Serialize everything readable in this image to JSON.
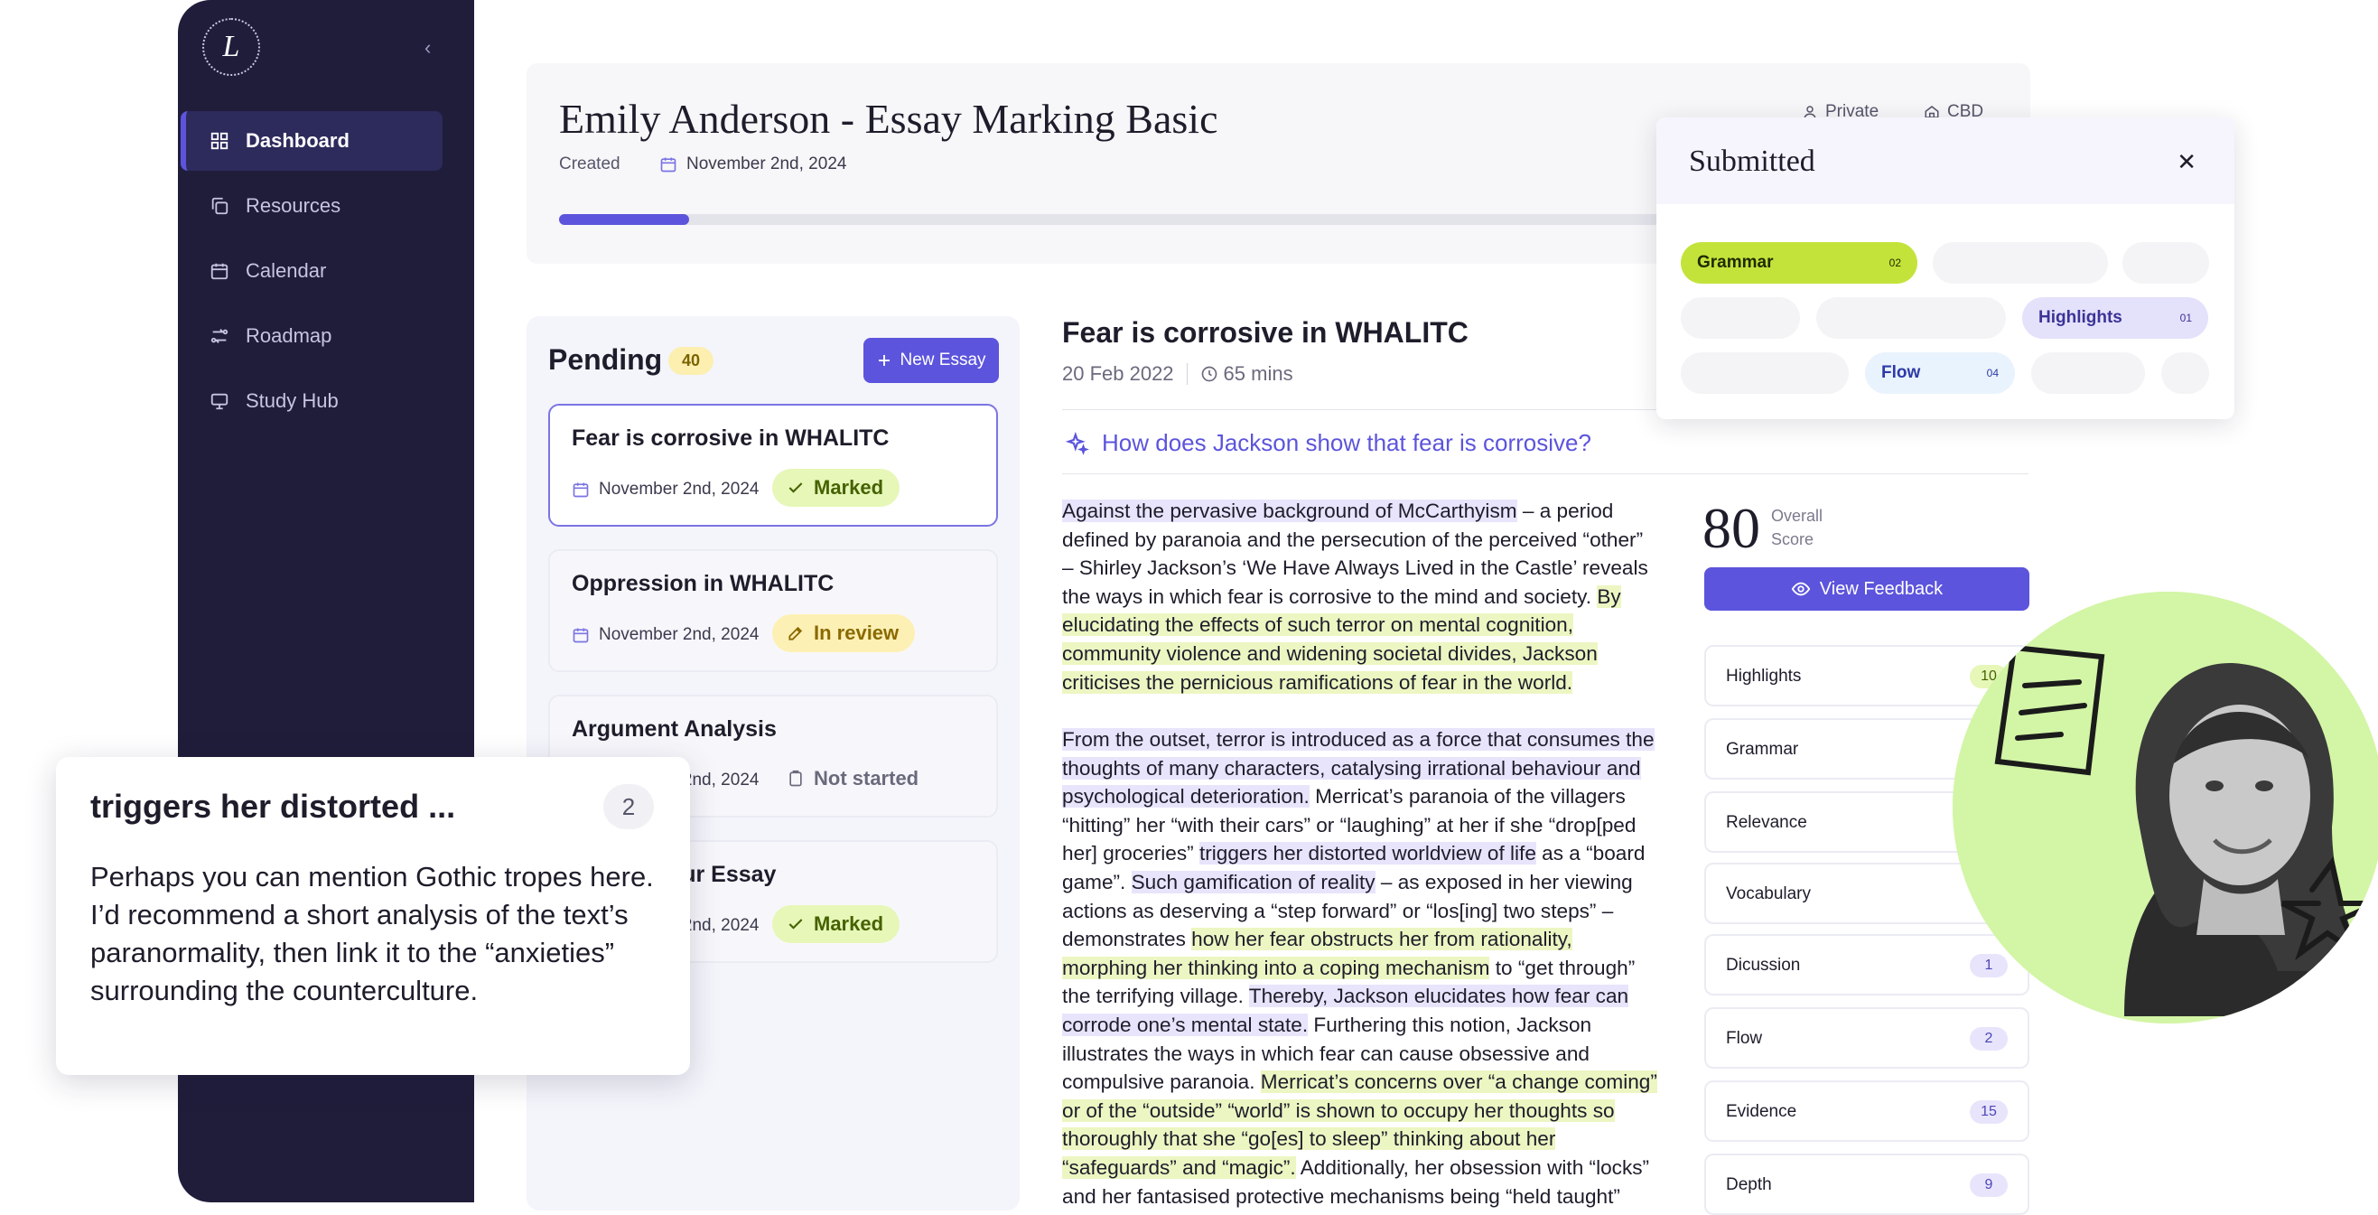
{
  "sidebar": {
    "logo_letter": "L",
    "collapse_glyph": "‹",
    "items": [
      {
        "label": "Dashboard",
        "icon": "grid-icon",
        "active": true
      },
      {
        "label": "Resources",
        "icon": "copy-icon"
      },
      {
        "label": "Calendar",
        "icon": "calendar-icon"
      },
      {
        "label": "Roadmap",
        "icon": "route-icon"
      },
      {
        "label": "Study Hub",
        "icon": "monitor-icon"
      }
    ]
  },
  "header": {
    "title": "Emily Anderson - Essay Marking Basic",
    "created_label": "Created",
    "created_date": "November 2nd, 2024",
    "visibility": "Private",
    "campus": "CBD",
    "progress": 0.115
  },
  "pending": {
    "title": "Pending",
    "count": "40",
    "new_button": "New Essay",
    "essays": [
      {
        "title": "Fear is corrosive in WHALITC",
        "date": "November 2nd, 2024",
        "status": "Marked"
      },
      {
        "title": "Oppression in WHALITC",
        "date": "November 2nd, 2024",
        "status": "In review"
      },
      {
        "title": "Argument Analysis",
        "date": "November 2nd, 2024",
        "status": "Not started"
      },
      {
        "title": "The Humour Essay",
        "date": "November 2nd, 2024",
        "status": "Marked"
      }
    ]
  },
  "essay": {
    "title": "Fear is corrosive in WHALITC",
    "date": "20 Feb 2022",
    "duration": "65 mins",
    "question": "How does Jackson show that fear is corrosive?",
    "p1": [
      {
        "t": "Against the pervasive background of McCarthyism",
        "h": "p"
      },
      {
        "t": " – a period defined by paranoia and the persecution of the perceived “other” – Shirley Jackson’s ‘We Have Always Lived in the Castle’ reveals the ways in which fear is corrosive to the mind and society. "
      },
      {
        "t": "By elucidating the effects of such terror on mental cognition, community violence and widening societal divides, Jackson criticises the pernicious ramifications of fear in the world.",
        "h": "g"
      }
    ],
    "p2": [
      {
        "t": "From the outset, terror is introduced as a force that consumes the thoughts of many characters, catalysing irrational behaviour and psychological deterioration.",
        "h": "p"
      },
      {
        "t": " Merricat’s paranoia of the villagers “hitting” her “with their cars” or “laughing” at her if she “drop[ped her] groceries” "
      },
      {
        "t": "triggers her distorted worldview of life",
        "h": "p"
      },
      {
        "t": " as a “board game”. "
      },
      {
        "t": "Such gamification of reality",
        "h": "p"
      },
      {
        "t": " – as exposed in her viewing actions as deserving a “step forward” or “los[ing] two steps” – demonstrates "
      },
      {
        "t": "how her fear obstructs her from rationality, morphing her thinking into a coping mechanism",
        "h": "g"
      },
      {
        "t": " to “get through” the terrifying village. "
      },
      {
        "t": "Thereby, Jackson elucidates how fear can corrode one’s mental state.",
        "h": "p"
      },
      {
        "t": " Furthering this notion, Jackson illustrates the ways in which fear can cause obsessive and compulsive paranoia. "
      },
      {
        "t": "Merricat’s concerns over “a change coming” or of the “outside” “world” is shown to occupy her thoughts so thoroughly that she “go[es] to sleep” thinking about her “safeguards” and “magic”.",
        "h": "g"
      },
      {
        "t": " Additionally, her obsession with “locks” and her fantasised protective mechanisms being “held taught”"
      }
    ]
  },
  "score": {
    "value": "80",
    "label_line1": "Overall",
    "label_line2": "Score",
    "feedback_button": "View Feedback",
    "criteria": [
      {
        "label": "Highlights",
        "value": "10",
        "style": "green"
      },
      {
        "label": "Grammar",
        "value": ""
      },
      {
        "label": "Relevance",
        "value": ""
      },
      {
        "label": "Vocabulary",
        "value": ""
      },
      {
        "label": "Dicussion",
        "value": "1"
      },
      {
        "label": "Flow",
        "value": "2"
      },
      {
        "label": "Evidence",
        "value": "15"
      },
      {
        "label": "Depth",
        "value": "9"
      }
    ]
  },
  "submitted": {
    "title": "Submitted",
    "close_glyph": "✕",
    "tags": [
      {
        "label": "Grammar",
        "n": "02"
      },
      {
        "label": "Highlights",
        "n": "01"
      },
      {
        "label": "Flow",
        "n": "04"
      }
    ]
  },
  "comment": {
    "title": "triggers her distorted ...",
    "count": "2",
    "body": "Perhaps you can mention Gothic tropes here. I’d recommend a short analysis of the text’s paranormality, then link it to the “anxieties” surrounding the counterculture."
  },
  "colors": {
    "accent": "#5c54dc",
    "sidebar": "#1f1d3a",
    "highlight_purple": "#e8e4fb",
    "highlight_green": "#ecf6c2",
    "grammar_chip": "#c3e33b",
    "avatar_bg": "#d3f5a6"
  }
}
